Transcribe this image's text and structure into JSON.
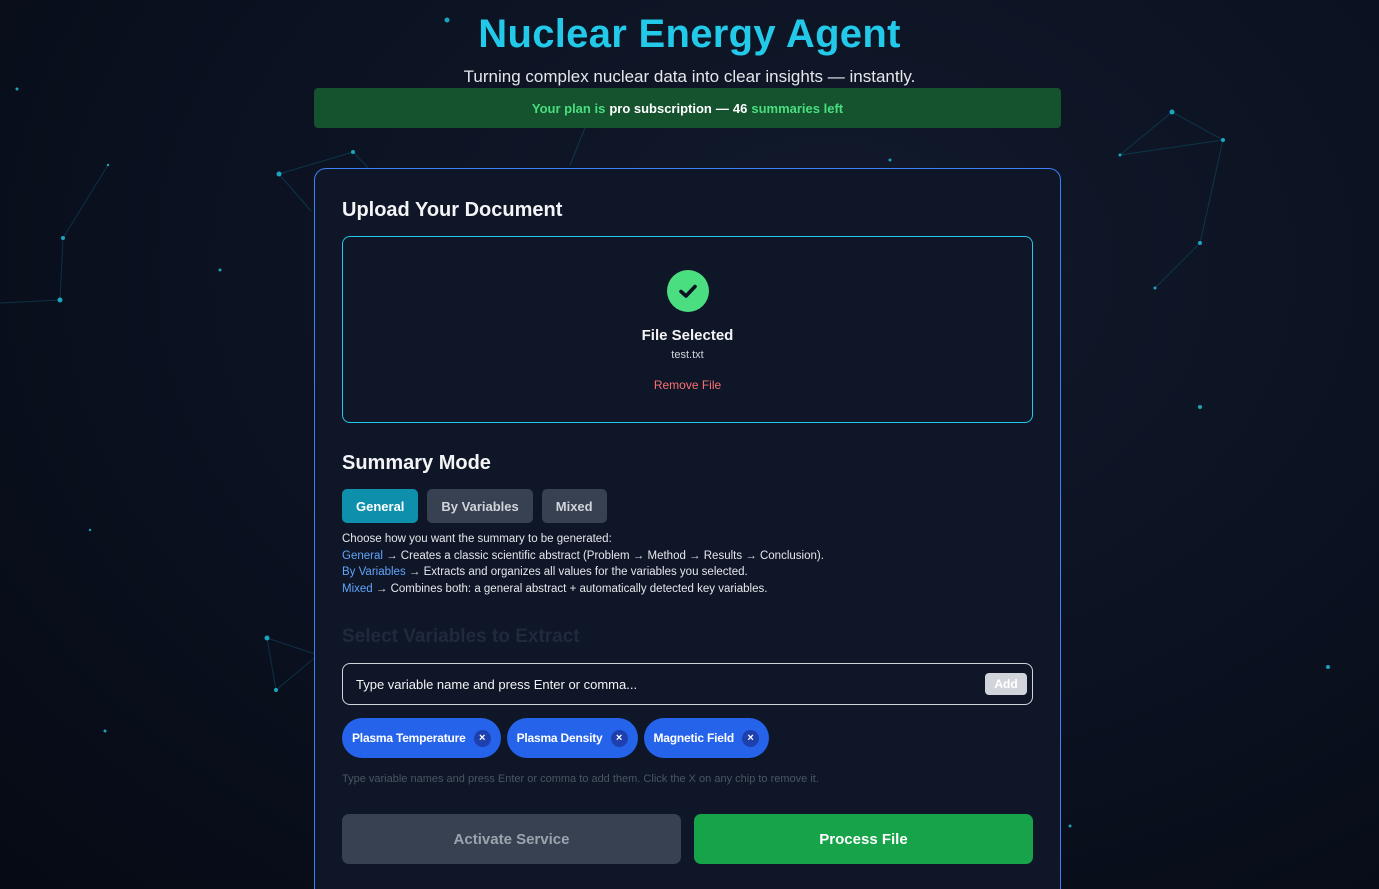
{
  "header": {
    "title": "Nuclear Energy Agent",
    "tagline": "Turning complex nuclear data into clear insights — instantly."
  },
  "plan_banner": {
    "prefix": "Your plan is",
    "plan_name": "pro subscription",
    "separator": "—",
    "remaining_count": "46",
    "suffix": "summaries left"
  },
  "upload": {
    "heading": "Upload Your Document",
    "status_label": "File Selected",
    "file_name": "test.txt",
    "remove_label": "Remove File"
  },
  "summary_mode": {
    "heading": "Summary Mode",
    "modes": [
      {
        "label": "General",
        "active": true
      },
      {
        "label": "By Variables",
        "active": false
      },
      {
        "label": "Mixed",
        "active": false
      }
    ],
    "help_intro": "Choose how you want the summary to be generated:",
    "help_items": [
      {
        "term": "General",
        "text": " → Creates a classic scientific abstract (Problem → Method → Results → Conclusion)."
      },
      {
        "term": "By Variables",
        "text": " → Extracts and organizes all values for the variables you selected."
      },
      {
        "term": "Mixed",
        "text": " → Combines both: a general abstract + automatically detected key variables."
      }
    ]
  },
  "variables": {
    "heading": "Select Variables to Extract",
    "input_placeholder": "Type variable name and press Enter or comma...",
    "add_label": "Add",
    "chips": [
      "Plasma Temperature",
      "Plasma Density",
      "Magnetic Field"
    ],
    "chip_remove_glyph": "×",
    "hint": "Type variable names and press Enter or comma to add them. Click the X on any chip to remove it."
  },
  "actions": {
    "activate_label": "Activate Service",
    "process_label": "Process File"
  },
  "icons": {
    "file_status": "check-circle-icon",
    "chip_remove": "close-icon"
  },
  "colors": {
    "accent": "#22c9e8",
    "plan_banner_bg": "#14532d",
    "plan_banner_text": "#4ade80",
    "mode_active": "#0e90ad",
    "chip": "#2563eb",
    "process_button": "#16a34a",
    "remove_link": "#f87171"
  }
}
